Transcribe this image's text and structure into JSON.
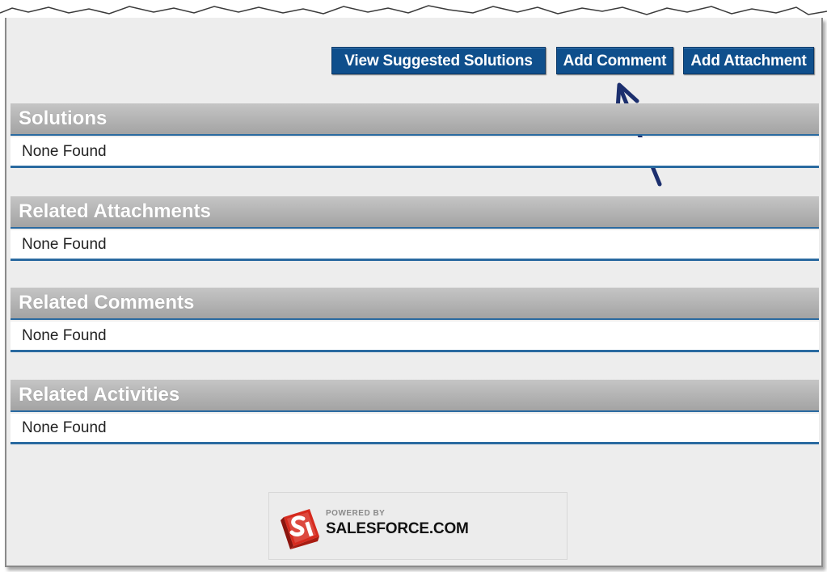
{
  "toolbar": {
    "view_suggested_solutions": "View Suggested Solutions",
    "add_comment": "Add Comment",
    "add_attachment": "Add Attachment"
  },
  "sections": [
    {
      "title": "Solutions",
      "body": "None Found"
    },
    {
      "title": "Related Attachments",
      "body": "None Found"
    },
    {
      "title": "Related Comments",
      "body": "None Found"
    },
    {
      "title": "Related Activities",
      "body": "None Found"
    }
  ],
  "footer": {
    "powered_by": "POWERED BY",
    "brand": "SALESFORCE.COM",
    "logo_icon": "salesforce-logo-icon"
  },
  "annotation": {
    "arrow_icon": "callout-arrow-icon",
    "arrow_color": "#1c2f6e"
  },
  "colors": {
    "button_bg": "#0f4f8c",
    "section_rule": "#2a6aa0",
    "header_gray": "#b4b4b4"
  }
}
